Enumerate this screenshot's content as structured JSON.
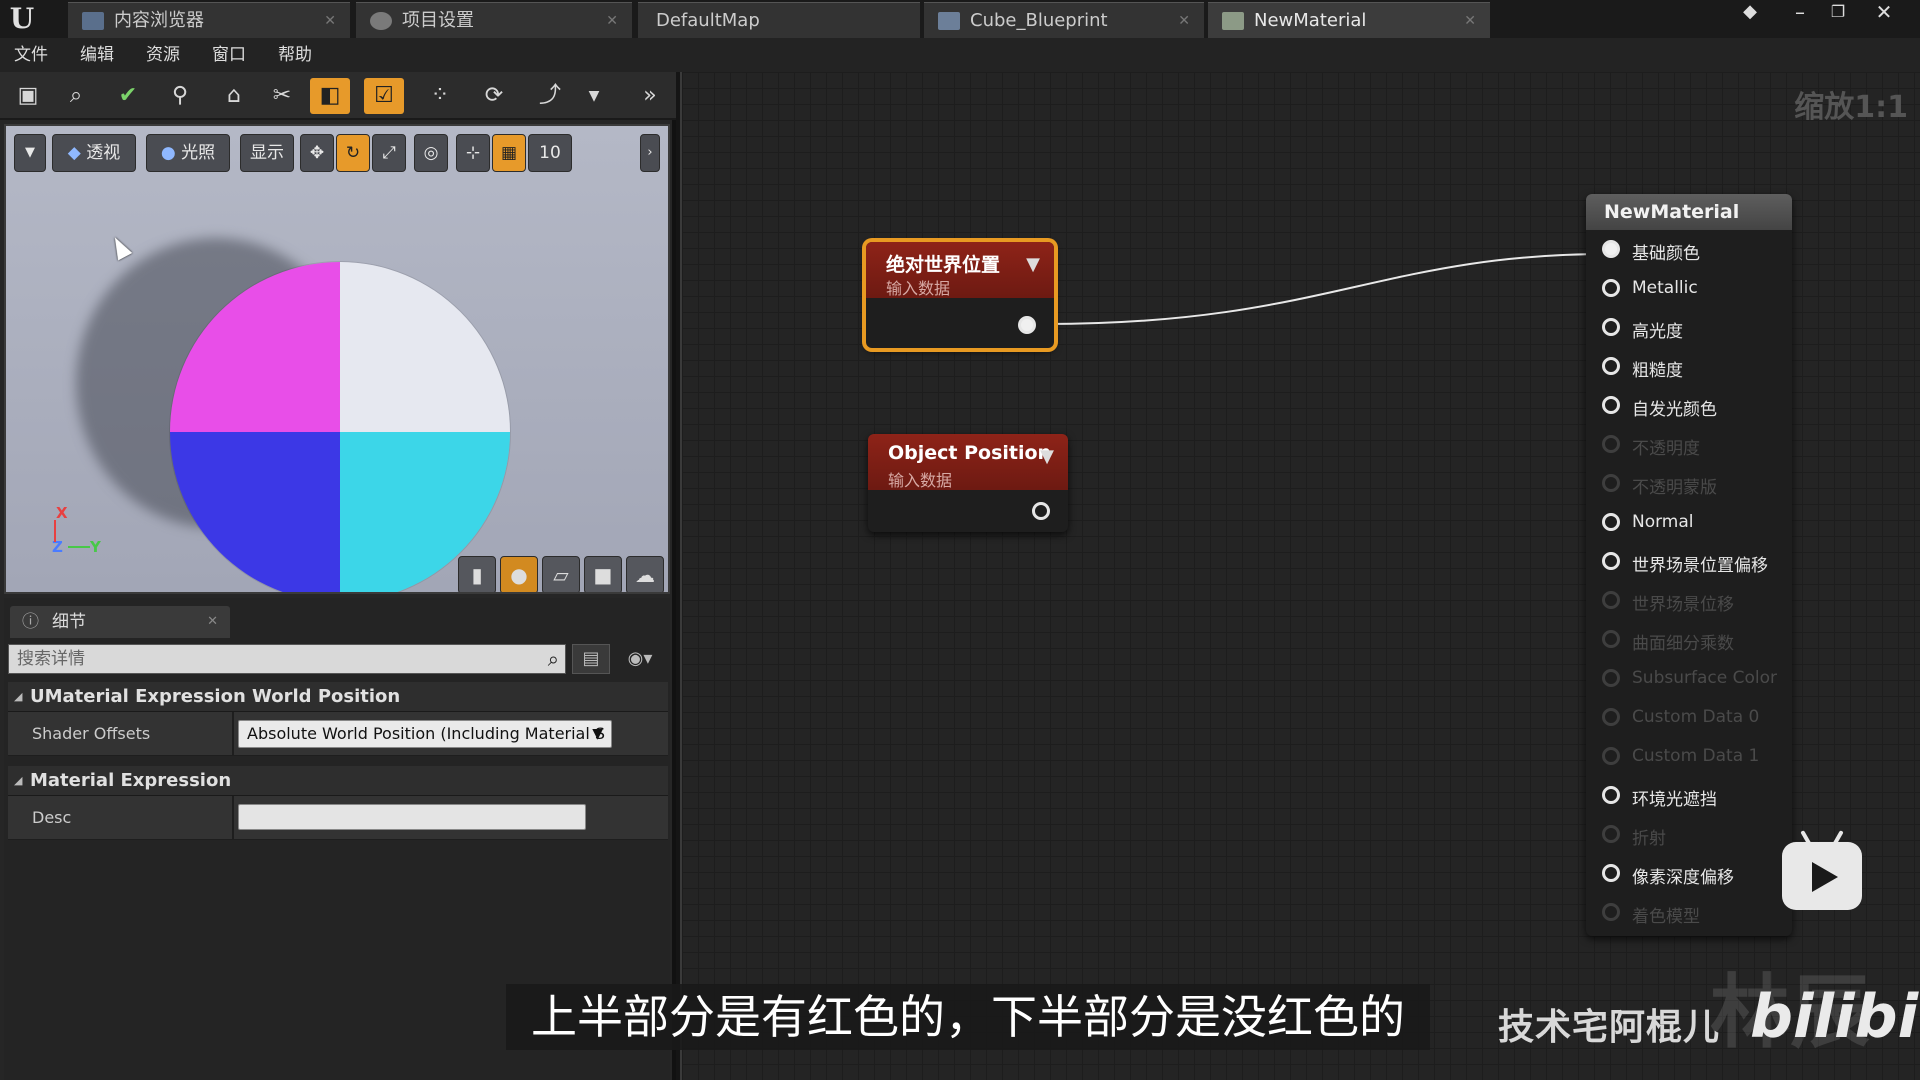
{
  "tabs": [
    {
      "label": "内容浏览器",
      "icon": "content-browser-icon"
    },
    {
      "label": "项目设置",
      "icon": "settings-gear-icon"
    },
    {
      "label": "DefaultMap",
      "icon": ""
    },
    {
      "label": "Cube_Blueprint",
      "icon": "blueprint-icon"
    },
    {
      "label": "NewMaterial",
      "icon": "material-icon"
    }
  ],
  "menu": [
    "文件",
    "编辑",
    "资源",
    "窗口",
    "帮助"
  ],
  "toolbar": {
    "icons": [
      "save-icon",
      "browse-icon",
      "apply-icon",
      "search-icon",
      "home-icon",
      "clean-icon",
      "live-preview-icon",
      "live-update-icon",
      "stats-icon",
      "mobile-stats-icon",
      "hierarchy-icon",
      "more-icon"
    ]
  },
  "viewport": {
    "perspective_label": "透视",
    "lit_label": "光照",
    "show_label": "显示",
    "grid_snap_value": "10",
    "axis_x": "X",
    "axis_y": "Y",
    "axis_z": "Z",
    "colors": {
      "top_left": "#e84ee8",
      "top_right": "#e6e8f0",
      "bottom_left": "#3c38e6",
      "bottom_right": "#3cd6e8"
    }
  },
  "details": {
    "tab_label": "细节",
    "search_placeholder": "搜索详情",
    "section1": "UMaterial Expression World Position",
    "shader_offsets_label": "Shader Offsets",
    "shader_offsets_value": "Absolute World Position (Including Material S",
    "section2": "Material Expression",
    "desc_label": "Desc",
    "desc_value": ""
  },
  "graph": {
    "zoom_label": "缩放1:1",
    "node1": {
      "title": "绝对世界位置",
      "subtitle": "输入数据"
    },
    "node2": {
      "title": "Object Position",
      "subtitle": "输入数据"
    },
    "material": {
      "title": "NewMaterial",
      "inputs": [
        {
          "label": "基础颜色",
          "enabled": true,
          "connected": true
        },
        {
          "label": "Metallic",
          "enabled": true
        },
        {
          "label": "高光度",
          "enabled": true
        },
        {
          "label": "粗糙度",
          "enabled": true
        },
        {
          "label": "自发光颜色",
          "enabled": true
        },
        {
          "label": "不透明度",
          "enabled": false
        },
        {
          "label": "不透明蒙版",
          "enabled": false
        },
        {
          "label": "Normal",
          "enabled": true
        },
        {
          "label": "世界场景位置偏移",
          "enabled": true
        },
        {
          "label": "世界场景位移",
          "enabled": false
        },
        {
          "label": "曲面细分乘数",
          "enabled": false
        },
        {
          "label": "Subsurface Color",
          "enabled": false
        },
        {
          "label": "Custom Data 0",
          "enabled": false
        },
        {
          "label": "Custom Data 1",
          "enabled": false
        },
        {
          "label": "环境光遮挡",
          "enabled": true
        },
        {
          "label": "折射",
          "enabled": false
        },
        {
          "label": "像素深度偏移",
          "enabled": true
        },
        {
          "label": "着色模型",
          "enabled": false
        }
      ]
    }
  },
  "overlay": {
    "subtitle": "上半部分是有红色的，下半部分是没红色的",
    "channel": "技术宅阿棍儿",
    "site_logo": "bilibili",
    "watermark": "林辰"
  }
}
